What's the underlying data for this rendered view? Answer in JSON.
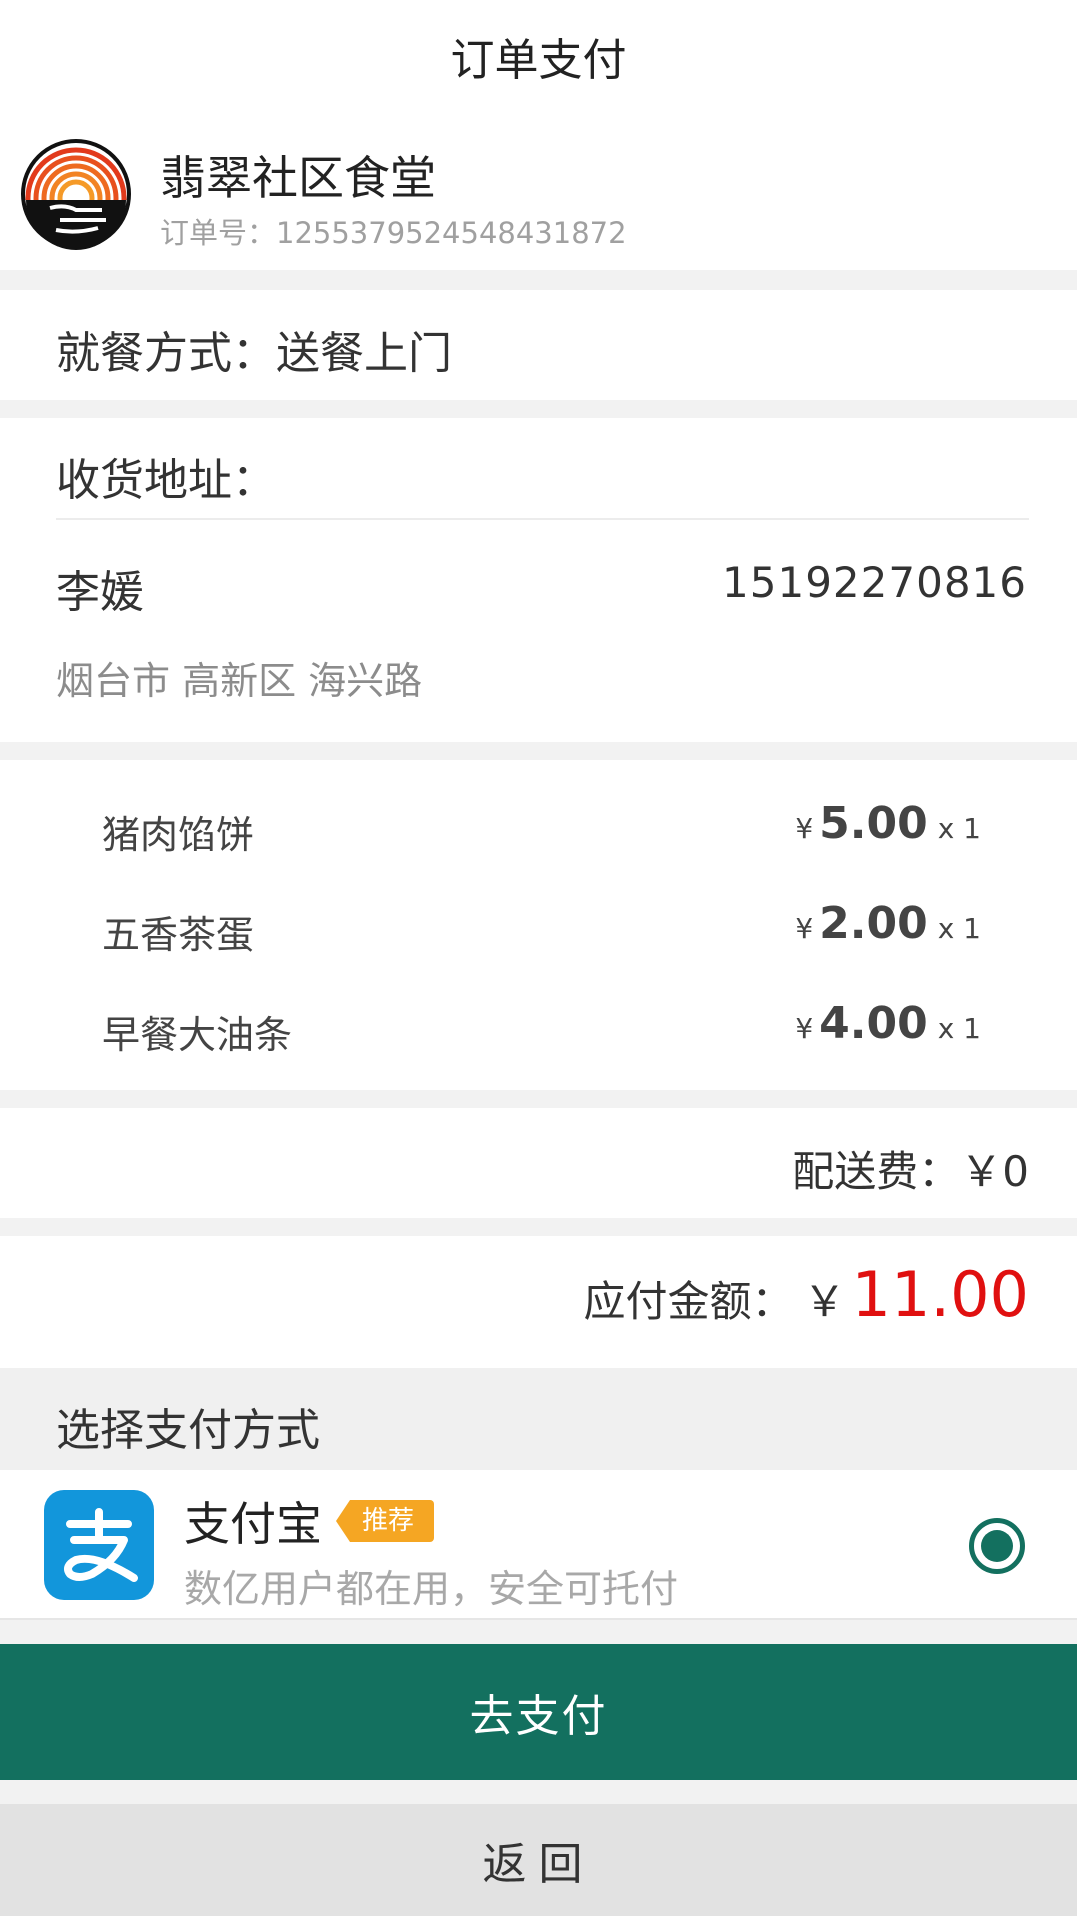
{
  "title": "订单支付",
  "shop": {
    "name": "翡翠社区食堂",
    "order_no": "订单号：1255379524548431872"
  },
  "dining": {
    "text": "就餐方式：送餐上门"
  },
  "address": {
    "label": "收货地址：",
    "name": "李媛",
    "phone": "15192270816",
    "detail": "烟台市 高新区 海兴路"
  },
  "items": [
    {
      "name": "猪肉馅饼",
      "currency": "¥",
      "price": "5.00",
      "qty": "x 1"
    },
    {
      "name": "五香茶蛋",
      "currency": "¥",
      "price": "2.00",
      "qty": "x 1"
    },
    {
      "name": "早餐大油条",
      "currency": "¥",
      "price": "4.00",
      "qty": "x 1"
    }
  ],
  "delivery": {
    "label": "配送费：",
    "value": "￥0"
  },
  "total": {
    "label": "应付金额：",
    "currency": "￥",
    "amount": "11.00"
  },
  "payment": {
    "header": "选择支付方式",
    "option": {
      "name": "支付宝",
      "badge": "推荐",
      "description": "数亿用户都在用，安全可托付",
      "icon": "alipay-icon",
      "selected": true
    }
  },
  "buttons": {
    "pay": "去支付",
    "back": "返回"
  },
  "colors": {
    "primary": "#13705f",
    "price_red": "#e01010",
    "badge": "#f5a623",
    "alipay_blue": "#1296db"
  }
}
